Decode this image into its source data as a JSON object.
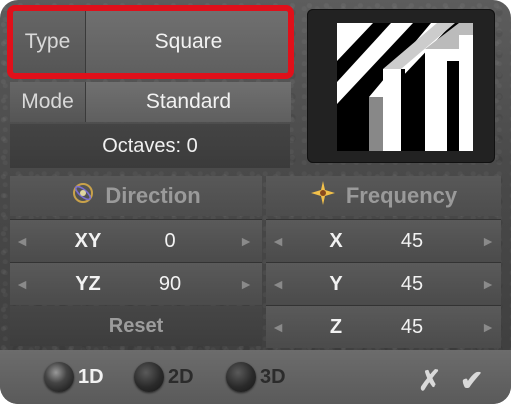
{
  "type_row": {
    "label": "Type",
    "value": "Square"
  },
  "mode_row": {
    "label": "Mode",
    "value": "Standard"
  },
  "octaves_text": "Octaves: 0",
  "sections": {
    "direction": "Direction",
    "frequency": "Frequency"
  },
  "direction_rows": [
    {
      "axis": "XY",
      "value": "0"
    },
    {
      "axis": "YZ",
      "value": "90"
    }
  ],
  "frequency_rows": [
    {
      "axis": "X",
      "value": "45"
    },
    {
      "axis": "Y",
      "value": "45"
    },
    {
      "axis": "Z",
      "value": "45"
    }
  ],
  "reset_label": "Reset",
  "dimensions": [
    {
      "label": "1D",
      "selected": true
    },
    {
      "label": "2D",
      "selected": false
    },
    {
      "label": "3D",
      "selected": false
    }
  ],
  "actions": {
    "cancel": "✗",
    "ok": "✔"
  },
  "colors": {
    "highlight": "#e0101a"
  },
  "icons": {
    "direction": "atom-icon",
    "frequency": "spark-icon",
    "left_arrow": "◄",
    "right_arrow": "►"
  }
}
